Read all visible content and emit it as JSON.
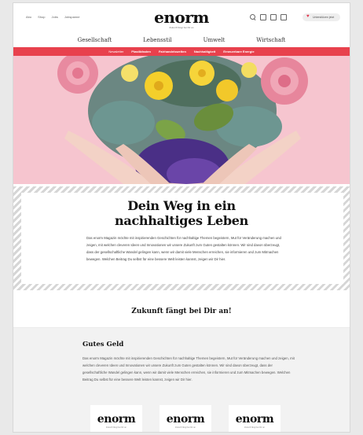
{
  "header": {
    "top_links": [
      "Abo",
      "Shop",
      "Jobs",
      "Jobspanne"
    ],
    "brand": "enorm",
    "tagline": "Zukunft fängt bei Dir an",
    "icons": [
      "search-icon",
      "box-icon",
      "box-icon",
      "box-icon"
    ],
    "pill_label": "Unterstützen jetzt"
  },
  "nav": {
    "main": [
      "Gesellschaft",
      "Lebensstil",
      "Umwelt",
      "Wirtschaft"
    ],
    "sub": [
      "Newsletter",
      "Plastikfasten",
      "Fairhandelswelten",
      "Nachhaltigkeit",
      "Erneuerbare Energie"
    ]
  },
  "hero": {
    "background": "#f6c5cf"
  },
  "article": {
    "headline_line1": "Dein Weg in ein",
    "headline_line2": "nachhaltiges Leben",
    "intro": "Das enorm Magazin möchte mit inspirierenden Geschichten für nachhaltige Themen begeistern, Mut für Veränderung machen und zeigen, mit welchen cleveren Ideen und Innovationen wir unsere Zukunft zum Guten gestalten können. Wir sind davon überzeugt, dass der gesellschaftliche Wandel gelingen kann, wenn wir damit viele Menschen erreichen, sie informieren und zum Mitmachen bewegen. Welchen Beitrag Du selbst für eine bessere Welt leisten kannst, zeigen wir Dir hier."
  },
  "motto": "Zukunft fängt bei Dir an!",
  "section": {
    "title": "Gutes Geld",
    "text": "Das enorm Magazin möchte mit inspirierenden Geschichten für nachhaltige Themen begeistern, Mut für Veränderung machen und zeigen, mit welchen cleveren Ideen und Innovationen wir unsere Zukunft zum Guten gestalten können. Wir sind davon überzeugt, dass der gesellschaftliche Wandel gelingen kann, wenn wir damit viele Menschen erreichen, sie informieren und zum Mitmachen bewegen. Welchen Beitrag Du selbst für eine bessere Welt leisten kannst, zeigen wir Dir hier.",
    "logos": [
      {
        "word": "enorm",
        "sub": "Zukunft fängt bei Dir an"
      },
      {
        "word": "enorm",
        "sub": "Zukunft fängt bei Dir an"
      },
      {
        "word": "enorm",
        "sub": "Zukunft fängt bei Dir an"
      }
    ]
  },
  "colors": {
    "accent": "#e8414d",
    "hero_pink": "#f6c5cf"
  }
}
